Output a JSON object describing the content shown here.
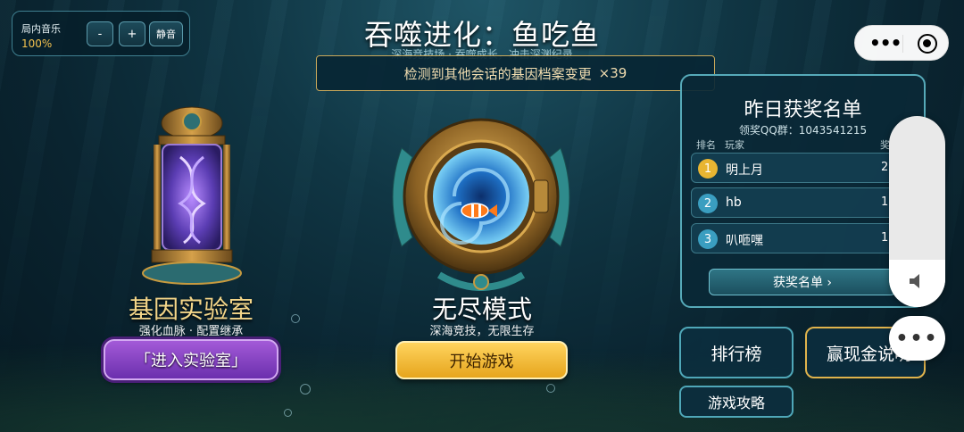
{
  "music": {
    "label": "局内音乐",
    "volume": "100%",
    "minus": "-",
    "plus": "+",
    "mute": "静音"
  },
  "title": "吞噬进化：鱼吃鱼",
  "subtitle": "深海竞技场 · 吞噬成长，冲击深渊纪录",
  "notice": {
    "text": "检测到其他会话的基因档案变更",
    "count": "×39"
  },
  "lab": {
    "title": "基因实验室",
    "subtitle": "强化血脉 · 配置继承",
    "button": "「进入实验室」"
  },
  "endless": {
    "title": "无尽模式",
    "subtitle": "深海竞技，无限生存",
    "button": "开始游戏"
  },
  "winners": {
    "title": "昨日获奖名单",
    "qq": "领奖QQ群：1043541215",
    "col_rank": "排名",
    "col_player": "玩家",
    "col_reward": "奖",
    "rows": [
      {
        "rank": "1",
        "name": "明上月",
        "value": "2",
        "color": "#e8b532"
      },
      {
        "rank": "2",
        "name": "hb",
        "value": "1",
        "color": "#3a9ec0"
      },
      {
        "rank": "3",
        "name": "叭咂嘿",
        "value": "1",
        "color": "#3a9ec0"
      }
    ],
    "button": "获奖名单 ›"
  },
  "buttons": {
    "leaderboard": "排行榜",
    "cash": "赢现金说明",
    "guide": "游戏攻略"
  },
  "system": {
    "volume_level": 0.25,
    "more": "•••"
  }
}
